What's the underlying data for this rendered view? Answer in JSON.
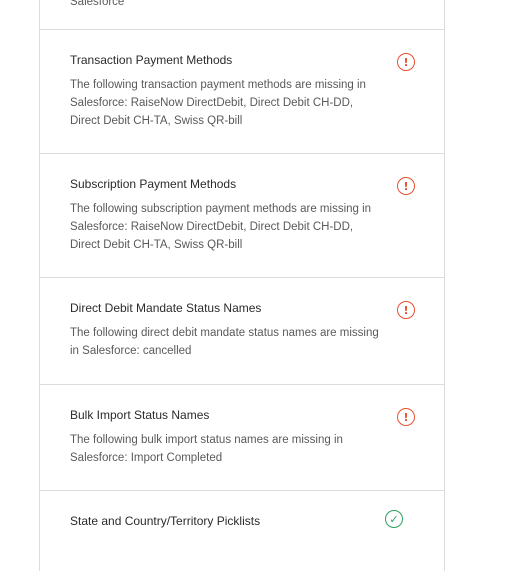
{
  "top_partial": {
    "text": "Salesforce"
  },
  "checks": [
    {
      "title": "Transaction Payment Methods",
      "description": "The following transaction payment methods are missing in Salesforce: RaiseNow DirectDebit, Direct Debit CH-DD, Direct Debit CH-TA, Swiss QR-bill",
      "status": "warning",
      "status_icon": "warning-circle-icon",
      "status_glyph": "!"
    },
    {
      "title": "Subscription Payment Methods",
      "description": "The following subscription payment methods are missing in Salesforce: RaiseNow DirectDebit, Direct Debit CH-DD, Direct Debit CH-TA, Swiss QR-bill",
      "status": "warning",
      "status_icon": "warning-circle-icon",
      "status_glyph": "!"
    },
    {
      "title": "Direct Debit Mandate Status Names",
      "description": "The following direct debit mandate status names are missing in Salesforce: cancelled",
      "status": "warning",
      "status_icon": "warning-circle-icon",
      "status_glyph": "!"
    },
    {
      "title": "Bulk Import Status Names",
      "description": "The following bulk import status names are missing in Salesforce: Import Completed",
      "status": "warning",
      "status_icon": "warning-circle-icon",
      "status_glyph": "!"
    },
    {
      "title": "State and Country/Territory Picklists",
      "description": "",
      "status": "ok",
      "status_icon": "check-circle-icon",
      "status_glyph": "✓"
    }
  ],
  "colors": {
    "warning": "#e8512f",
    "ok": "#2aa15d",
    "border": "#dcdcdc"
  }
}
